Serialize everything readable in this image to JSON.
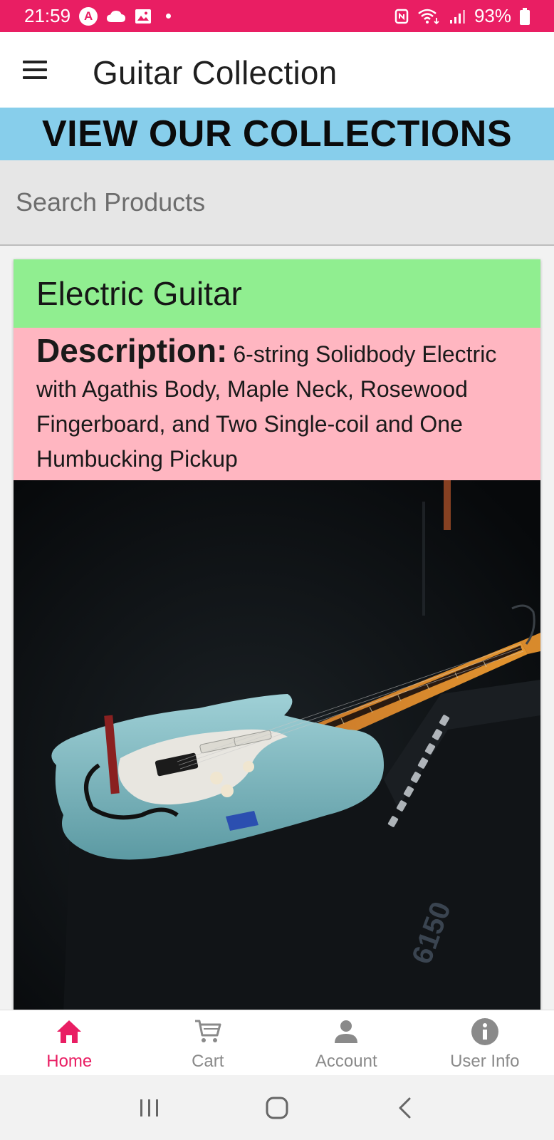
{
  "status_bar": {
    "time": "21:59",
    "battery": "93%",
    "left_icons": [
      "a-badge-icon",
      "cloud-icon",
      "image-icon",
      "dot-icon"
    ],
    "right_icons": [
      "nfc-icon",
      "wifi-icon",
      "signal-icon",
      "battery-icon"
    ],
    "color": "#e91e63"
  },
  "app_bar": {
    "title": "Guitar Collection"
  },
  "banner": {
    "text": "VIEW OUR COLLECTIONS",
    "color": "#87ceeb"
  },
  "search": {
    "placeholder": "Search Products",
    "value": ""
  },
  "product": {
    "title": "Electric Guitar",
    "title_bg": "#90ee90",
    "description_label": "Description:",
    "description": "6-string Solidbody Electric with Agathis Body, Maple Neck, Rosewood Fingerboard, and Two Single-coil and One Humbucking Pickup",
    "description_bg": "#ffb6c1",
    "image": "electric-guitar-photo"
  },
  "bottom_nav": {
    "items": [
      {
        "label": "Home",
        "icon": "home-icon",
        "active": true
      },
      {
        "label": "Cart",
        "icon": "cart-icon",
        "active": false
      },
      {
        "label": "Account",
        "icon": "person-icon",
        "active": false
      },
      {
        "label": "User Info",
        "icon": "info-icon",
        "active": false
      }
    ],
    "active_color": "#e91e63",
    "inactive_color": "#8a8a8a"
  },
  "system_nav": [
    "recents-icon",
    "home-circle-icon",
    "back-icon"
  ]
}
